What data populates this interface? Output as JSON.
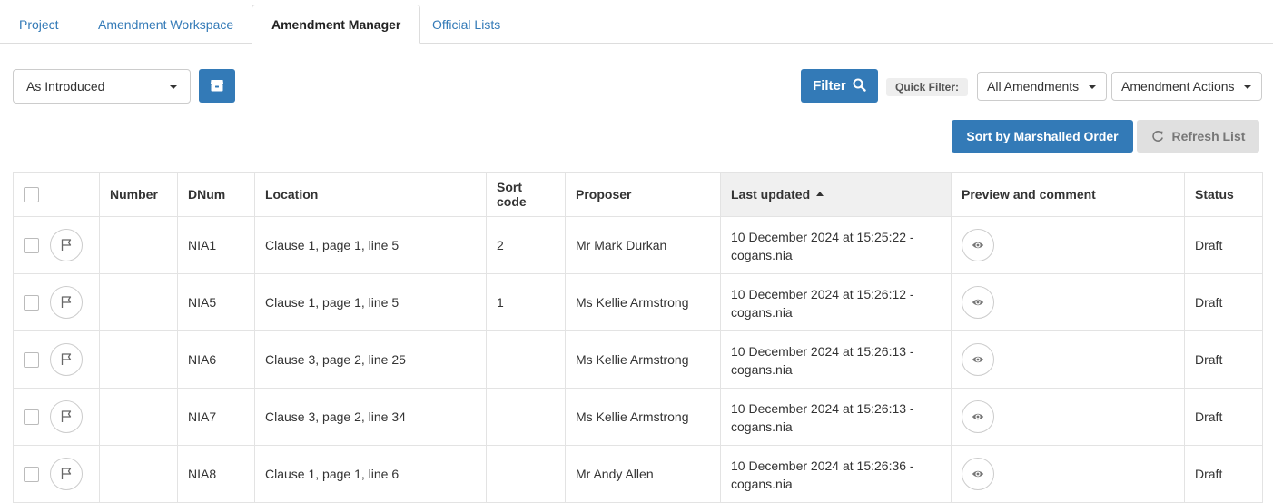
{
  "tabs": [
    {
      "label": "Project"
    },
    {
      "label": "Amendment Workspace"
    },
    {
      "label": "Amendment Manager",
      "active": true
    },
    {
      "label": "Official Lists"
    }
  ],
  "toolbar": {
    "version_select": "As Introduced",
    "archive_icon": "archive-icon",
    "filter_label": "Filter",
    "quick_filter_label": "Quick Filter:",
    "all_amendments": "All Amendments",
    "amendment_actions": "Amendment Actions",
    "sort_label": "Sort by Marshalled Order",
    "refresh_label": "Refresh List"
  },
  "colors": {
    "accent": "#337ab7",
    "link": "#337ab7"
  },
  "table": {
    "headers": [
      "Number",
      "DNum",
      "Location",
      "Sort code",
      "Proposer",
      "Last updated",
      "Preview and comment",
      "Status"
    ],
    "sorted_column": "Last updated",
    "rows": [
      {
        "number": "",
        "dnum": "NIA1",
        "location": "Clause 1, page 1, line 5",
        "sort_code": "2",
        "proposer": "Mr Mark Durkan",
        "updated_line1": "10 December 2024 at 15:25:22 -",
        "updated_line2": "cogans.nia",
        "status": "Draft"
      },
      {
        "number": "",
        "dnum": "NIA5",
        "location": "Clause 1, page 1, line 5",
        "sort_code": "1",
        "proposer": "Ms Kellie Armstrong",
        "updated_line1": "10 December 2024 at 15:26:12 -",
        "updated_line2": "cogans.nia",
        "status": "Draft"
      },
      {
        "number": "",
        "dnum": "NIA6",
        "location": "Clause 3, page 2, line 25",
        "sort_code": "",
        "proposer": "Ms Kellie Armstrong",
        "updated_line1": "10 December 2024 at 15:26:13 -",
        "updated_line2": "cogans.nia",
        "status": "Draft"
      },
      {
        "number": "",
        "dnum": "NIA7",
        "location": "Clause 3, page 2, line 34",
        "sort_code": "",
        "proposer": "Ms Kellie Armstrong",
        "updated_line1": "10 December 2024 at 15:26:13 -",
        "updated_line2": "cogans.nia",
        "status": "Draft"
      },
      {
        "number": "",
        "dnum": "NIA8",
        "location": "Clause 1, page 1, line 6",
        "sort_code": "",
        "proposer": "Mr Andy Allen",
        "updated_line1": "10 December 2024 at 15:26:36 -",
        "updated_line2": "cogans.nia",
        "status": "Draft"
      }
    ]
  }
}
